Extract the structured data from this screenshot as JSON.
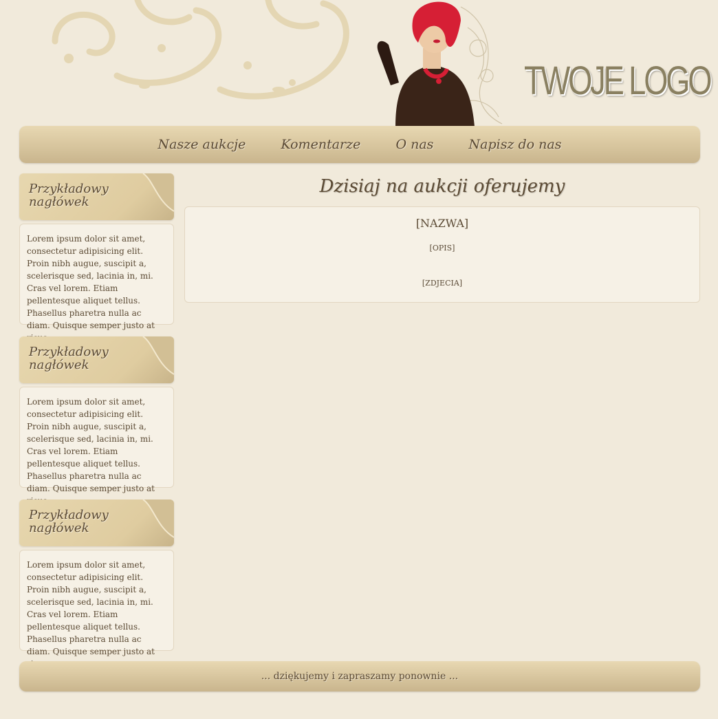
{
  "header": {
    "logo_text": "TWOJE LOGO"
  },
  "nav": {
    "items": [
      {
        "label": "Nasze aukcje"
      },
      {
        "label": "Komentarze"
      },
      {
        "label": "O nas"
      },
      {
        "label": "Napisz do nas"
      }
    ]
  },
  "sidebar": {
    "blocks": [
      {
        "heading": "Przykładowy nagłówek",
        "text": "Lorem ipsum dolor sit amet, consectetur adipisicing elit. Proin nibh augue, suscipit a, scelerisque sed, lacinia in, mi. Cras vel lorem. Etiam pellentesque aliquet tellus. Phasellus pharetra nulla ac diam. Quisque semper justo at risus."
      },
      {
        "heading": "Przykładowy nagłówek",
        "text": "Lorem ipsum dolor sit amet, consectetur adipisicing elit. Proin nibh augue, suscipit a, scelerisque sed, lacinia in, mi. Cras vel lorem. Etiam pellentesque aliquet tellus. Phasellus pharetra nulla ac diam. Quisque semper justo at risus."
      },
      {
        "heading": "Przykładowy nagłówek",
        "text": "Lorem ipsum dolor sit amet, consectetur adipisicing elit. Proin nibh augue, suscipit a, scelerisque sed, lacinia in, mi. Cras vel lorem. Etiam pellentesque aliquet tellus. Phasellus pharetra nulla ac diam. Quisque semper justo at risus."
      }
    ]
  },
  "main": {
    "title": "Dzisiaj na aukcji oferujemy",
    "item": {
      "name": "[NAZWA]",
      "description": "[OPIS]",
      "photos": "[ZDJECIA]"
    }
  },
  "footer": {
    "text": "... dziękujemy i zapraszamy ponownie ..."
  },
  "colors": {
    "background": "#f1eadb",
    "bar_top": "#e8d8b2",
    "bar_bottom": "#c9b58d",
    "text": "#5b4a34",
    "logo": "#8a8061",
    "accent_red": "#d61f35"
  },
  "icons": [
    "floral-swirl-decoration",
    "fashion-lady-illustration",
    "page-curl-icon"
  ]
}
